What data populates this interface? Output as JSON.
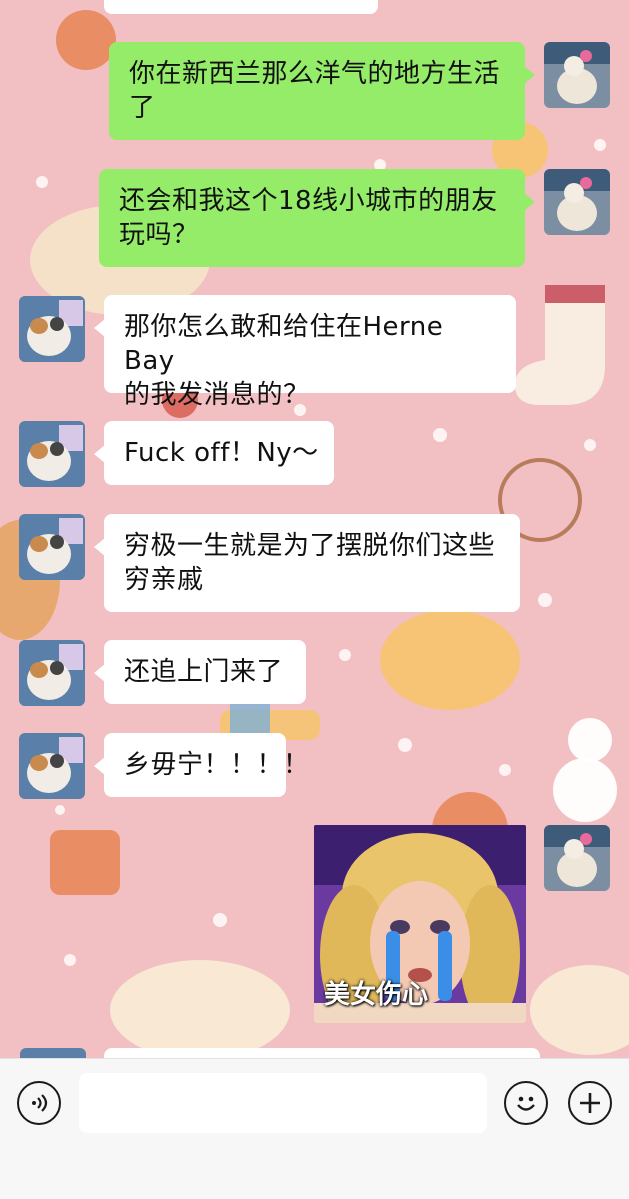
{
  "messages": [
    {
      "side": "out",
      "text": "你在新西兰那么洋气的地方生活\n了"
    },
    {
      "side": "out",
      "text": "还会和我这个18线小城市的朋友\n玩吗？"
    },
    {
      "side": "in",
      "text": "那你怎么敢和给住在Herne Bay\n的我发消息的？"
    },
    {
      "side": "in",
      "text": "Fuck off！Ny～"
    },
    {
      "side": "in",
      "text": "穷极一生就是为了摆脱你们这些\n穷亲戚"
    },
    {
      "side": "in",
      "text": "还追上门来了"
    },
    {
      "side": "in",
      "text": "乡毋宁！！！！"
    }
  ],
  "sticker": {
    "caption": "美女伤心"
  },
  "input_bar": {
    "voice_icon": "voice-icon",
    "emoji_icon": "emoji-icon",
    "plus_icon": "plus-icon"
  },
  "colors": {
    "outgoing_bubble": "#95ec69",
    "incoming_bubble": "#ffffff",
    "background": "#f2c0c3"
  }
}
